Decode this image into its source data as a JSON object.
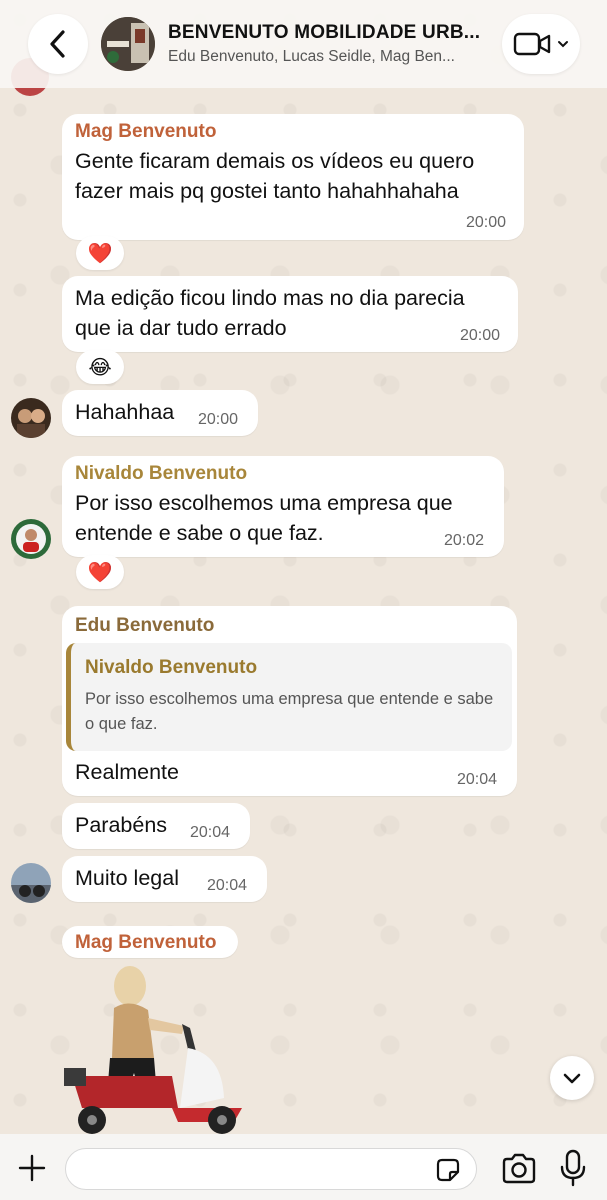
{
  "header": {
    "title": "BENVENUTO MOBILIDADE URB...",
    "members": "Edu Benvenuto, Lucas Seidle, Mag Ben..."
  },
  "messages": [
    {
      "sender": "Mag Benvenuto",
      "sender_color": "#c0623a",
      "text_lines": [
        "Gente ficaram demais os vídeos eu quero",
        "fazer mais pq gostei tanto hahahhahaha"
      ],
      "time": "20:00",
      "reaction": "❤️"
    },
    {
      "text_lines": [
        "Ma edição ficou lindo mas no dia parecia",
        "que ia dar tudo errado"
      ],
      "time": "20:00",
      "reaction": "😂"
    },
    {
      "text": "Hahahhaa",
      "time": "20:00"
    },
    {
      "sender": "Nivaldo Benvenuto",
      "sender_color": "#a8863a",
      "text_lines": [
        "Por isso escolhemos uma empresa que",
        "entende e sabe o que faz."
      ],
      "time": "20:02",
      "reaction": "❤️"
    },
    {
      "sender": "Edu Benvenuto",
      "sender_color": "#8a6a3a",
      "quote": {
        "name": "Nivaldo Benvenuto",
        "text": "Por isso escolhemos uma empresa que entende e sabe o que faz."
      },
      "text": "Realmente",
      "time": "20:04"
    },
    {
      "text": "Parabéns",
      "time": "20:04"
    },
    {
      "text": "Muito legal",
      "time": "20:04"
    },
    {
      "sender": "Mag Benvenuto",
      "sender_color": "#c0623a"
    }
  ],
  "composer": {
    "placeholder": ""
  },
  "icons": {
    "back": "chevron-left-icon",
    "video": "video-camera-icon",
    "plus": "plus-icon",
    "sticker": "sticker-icon",
    "camera": "camera-icon",
    "mic": "microphone-icon",
    "scroll": "chevron-down-icon"
  }
}
